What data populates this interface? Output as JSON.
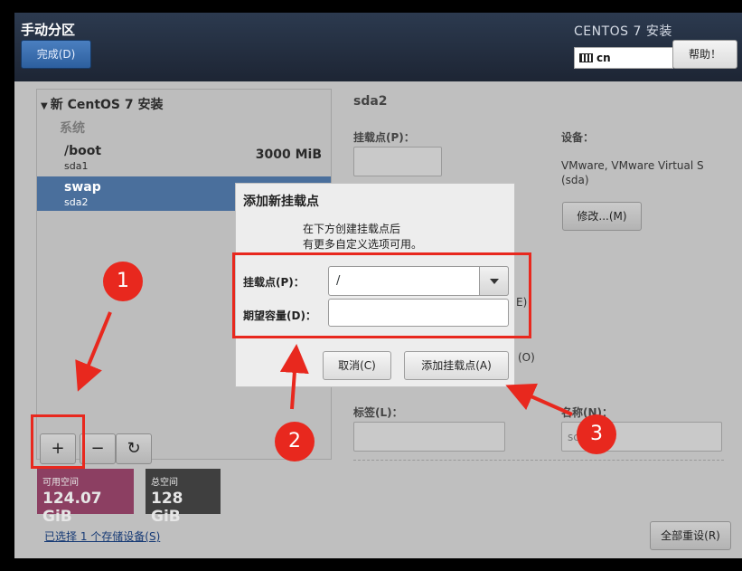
{
  "header": {
    "title": "手动分区",
    "done_button": "完成(D)",
    "product": "CENTOS 7 安装",
    "keyboard_layout": "cn",
    "help_button": "帮助！"
  },
  "tree": {
    "header": "新 CentOS 7 安装",
    "section": "系统",
    "partitions": [
      {
        "name": "/boot",
        "device": "sda1",
        "size": "3000 MiB"
      },
      {
        "name": "swap",
        "device": "sda2",
        "size": ""
      }
    ]
  },
  "toolbar": {
    "add": "+",
    "remove": "−",
    "refresh": "↻"
  },
  "space": {
    "free_label": "可用空间",
    "free_value": "124.07 GiB",
    "total_label": "总空间",
    "total_value": "128 GiB"
  },
  "storage_link": "已选择 1 个存储设备(S)",
  "detail": {
    "device_name": "sda2",
    "mountpoint_label": "挂载点(P)：",
    "device_label": "设备：",
    "device_value_1": "VMware, VMware Virtual S",
    "device_value_2": "(sda)",
    "modify_button": "修改...(M)",
    "partial_e": "E)",
    "partial_o": "(O)",
    "tag_label": "标签(L)：",
    "name_label": "名称(N)：",
    "name_value_partial": "sc",
    "reset_button": "全部重设(R)"
  },
  "dialog": {
    "title": "添加新挂载点",
    "desc_line1": "在下方创建挂载点后",
    "desc_line2": "有更多自定义选项可用。",
    "mount_label": "挂载点(P)：",
    "mount_value": "/",
    "capacity_label": "期望容量(D)：",
    "capacity_value": "",
    "cancel_button": "取消(C)",
    "add_button": "添加挂载点(A)"
  },
  "annotations": {
    "step1": "1",
    "step2": "2",
    "step3": "3"
  },
  "colors": {
    "annotation_red": "#e8281e",
    "selected_row": "#4a6f9c",
    "free_tile": "#8c3f62"
  }
}
